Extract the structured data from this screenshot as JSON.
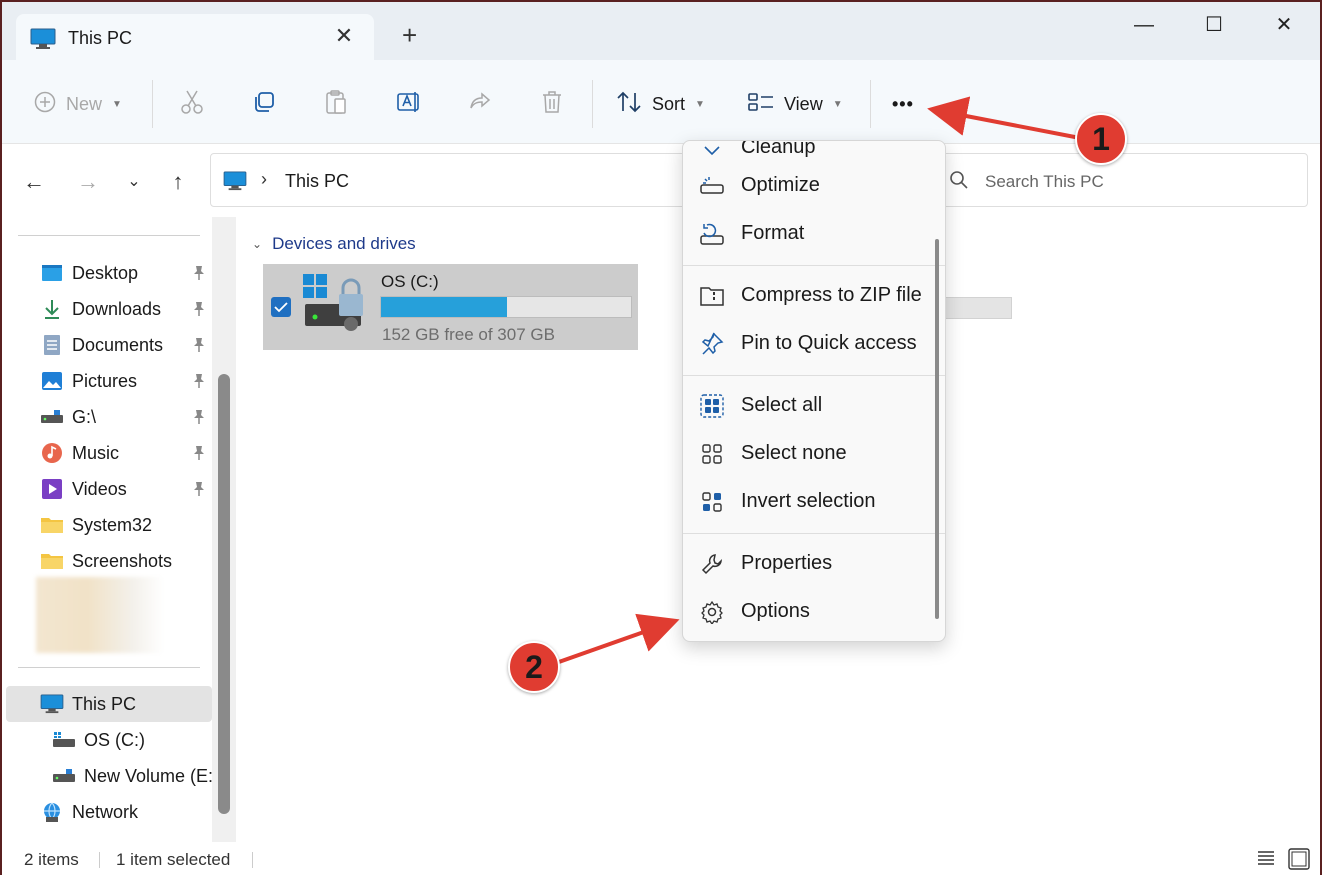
{
  "window": {
    "tab_title": "This PC",
    "close_tab": "✕",
    "new_tab": "+",
    "minimize": "—",
    "maximize": "☐",
    "close": "✕"
  },
  "toolbar": {
    "new_label": "New",
    "sort_label": "Sort",
    "view_label": "View",
    "more_label": "•••"
  },
  "address": {
    "separator": "›",
    "crumb": "This PC",
    "search_placeholder": "Search This PC"
  },
  "sidebar": {
    "quick_access": [
      {
        "label": "Desktop",
        "icon": "desktop-icon"
      },
      {
        "label": "Downloads",
        "icon": "download-icon"
      },
      {
        "label": "Documents",
        "icon": "document-icon"
      },
      {
        "label": "Pictures",
        "icon": "pictures-icon"
      },
      {
        "label": "G:\\",
        "icon": "drive-icon"
      },
      {
        "label": "Music",
        "icon": "music-icon"
      },
      {
        "label": "Videos",
        "icon": "video-icon"
      },
      {
        "label": "System32",
        "icon": "folder-icon"
      },
      {
        "label": "Screenshots",
        "icon": "folder-icon"
      }
    ],
    "this_pc": "This PC",
    "os_c": "OS (C:)",
    "new_volume": "New Volume (E:)",
    "network": "Network"
  },
  "content": {
    "group_header": "Devices and drives",
    "drive": {
      "name": "OS (C:)",
      "free_text": "152 GB free of 307 GB",
      "used_fraction": 0.505
    }
  },
  "menu": {
    "cleanup": "Cleanup",
    "optimize": "Optimize",
    "format": "Format",
    "compress": "Compress to ZIP file",
    "pin": "Pin to Quick access",
    "select_all": "Select all",
    "select_none": "Select none",
    "invert": "Invert selection",
    "properties": "Properties",
    "options": "Options"
  },
  "status": {
    "items": "2 items",
    "selected": "1 item selected"
  },
  "annotations": {
    "badge1": "1",
    "badge2": "2",
    "color": "#e03c31"
  },
  "colors": {
    "accent": "#1f6fc1",
    "drive_fill": "#26a0da"
  }
}
